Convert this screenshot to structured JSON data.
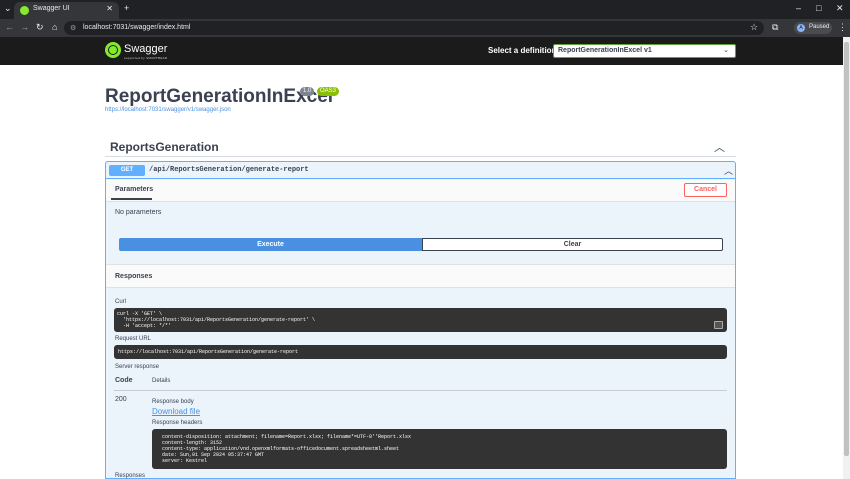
{
  "browser": {
    "tab_title": "Swagger UI",
    "tab_close": "✕",
    "new_tab": "+",
    "url": "localhost:7031/swagger/index.html",
    "profile_initial": "A",
    "profile_label": "Paused"
  },
  "swagger": {
    "logo_text": "Swagger",
    "logo_sub": "supported by SMARTBEAR",
    "definition_label": "Select a definition",
    "definition_value": "ReportGenerationInExcel v1"
  },
  "info": {
    "title": "ReportGenerationInExcel",
    "version": "1.0",
    "oas": "OAS3",
    "spec_url": "https://localhost:7031/swagger/v1/swagger.json"
  },
  "tag": {
    "name": "ReportsGeneration"
  },
  "operation": {
    "method": "GET",
    "path": "/api/ReportsGeneration/generate-report",
    "parameters_tab": "Parameters",
    "cancel_label": "Cancel",
    "no_params": "No parameters",
    "execute_label": "Execute",
    "clear_label": "Clear",
    "responses_title": "Responses",
    "curl_label": "Curl",
    "curl_text": "curl -X 'GET' \\\n  'https://localhost:7031/api/ReportsGeneration/generate-report' \\\n  -H 'accept: */*'",
    "request_url_label": "Request URL",
    "request_url": "https://localhost:7031/api/ReportsGeneration/generate-report",
    "server_response_label": "Server response",
    "code_header": "Code",
    "details_header": "Details",
    "status_code": "200",
    "response_body_label": "Response body",
    "download_label": "Download file",
    "response_headers_label": "Response headers",
    "response_headers_text": " content-disposition: attachment; filename=Report.xlsx; filename*=UTF-8''Report.xlsx \n content-length: 3152 \n content-type: application/vnd.openxmlformats-officedocument.spreadsheetml.sheet \n date: Sun,01 Sep 2024 05:37:47 GMT \n server: Kestrel ",
    "responses_footer": "Responses"
  },
  "colors": {
    "get_blue": "#61affe",
    "execute_blue": "#4990e2",
    "cancel_red": "#ff6060",
    "swagger_green": "#85ea2d",
    "topbar": "#1b1b1b"
  }
}
